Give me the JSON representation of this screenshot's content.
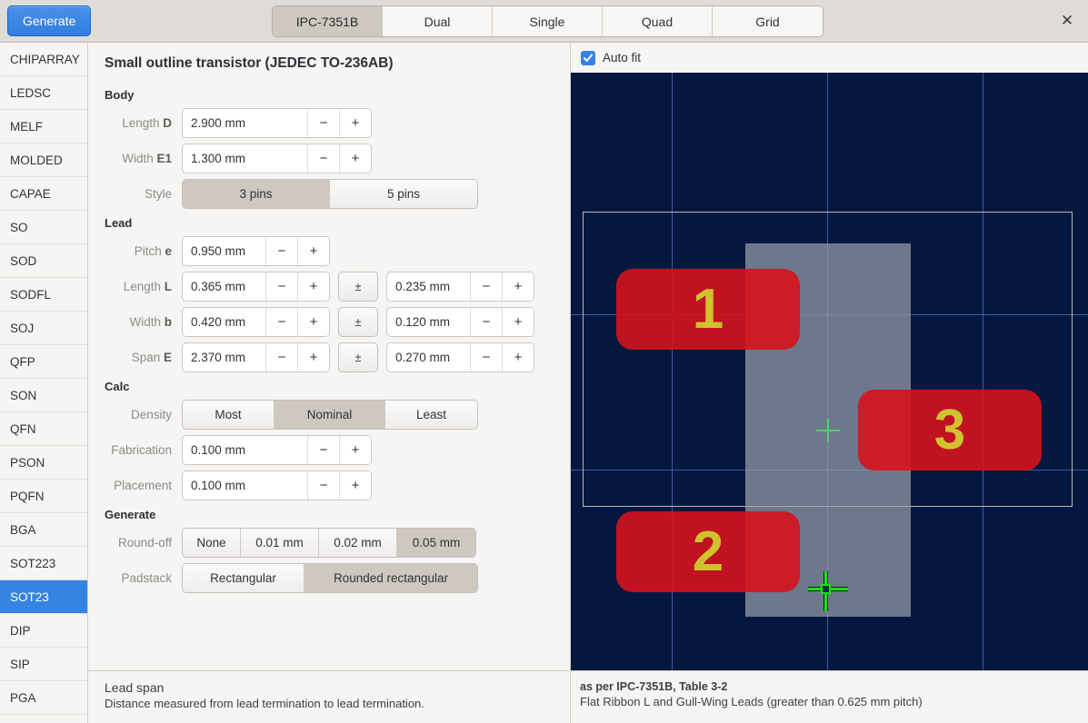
{
  "header": {
    "generate_label": "Generate",
    "close_icon": "close-icon",
    "tabs": [
      {
        "label": "IPC-7351B",
        "active": true
      },
      {
        "label": "Dual",
        "active": false
      },
      {
        "label": "Single",
        "active": false
      },
      {
        "label": "Quad",
        "active": false
      },
      {
        "label": "Grid",
        "active": false
      }
    ]
  },
  "sidebar": {
    "items": [
      {
        "label": "CHIPARRAY",
        "selected": false
      },
      {
        "label": "LEDSC",
        "selected": false
      },
      {
        "label": "MELF",
        "selected": false
      },
      {
        "label": "MOLDED",
        "selected": false
      },
      {
        "label": "CAPAE",
        "selected": false
      },
      {
        "label": "SO",
        "selected": false
      },
      {
        "label": "SOD",
        "selected": false
      },
      {
        "label": "SODFL",
        "selected": false
      },
      {
        "label": "SOJ",
        "selected": false
      },
      {
        "label": "QFP",
        "selected": false
      },
      {
        "label": "SON",
        "selected": false
      },
      {
        "label": "QFN",
        "selected": false
      },
      {
        "label": "PSON",
        "selected": false
      },
      {
        "label": "PQFN",
        "selected": false
      },
      {
        "label": "BGA",
        "selected": false
      },
      {
        "label": "SOT223",
        "selected": false
      },
      {
        "label": "SOT23",
        "selected": true
      },
      {
        "label": "DIP",
        "selected": false
      },
      {
        "label": "SIP",
        "selected": false
      },
      {
        "label": "PGA",
        "selected": false
      }
    ]
  },
  "form": {
    "title": "Small outline transistor (JEDEC TO-236AB)",
    "sections": {
      "body": {
        "heading": "Body",
        "length": {
          "label": "Length",
          "symbol": "D",
          "value": "2.900 mm"
        },
        "width": {
          "label": "Width",
          "symbol": "E1",
          "value": "1.300 mm"
        },
        "style": {
          "label": "Style",
          "options": [
            {
              "label": "3 pins",
              "active": true
            },
            {
              "label": "5 pins",
              "active": false
            }
          ]
        }
      },
      "lead": {
        "heading": "Lead",
        "pitch": {
          "label": "Pitch",
          "symbol": "e",
          "value": "0.950 mm"
        },
        "length": {
          "label": "Length",
          "symbol": "L",
          "value": "0.365 mm",
          "tol_symbol": "±",
          "tol_value": "0.235 mm"
        },
        "width": {
          "label": "Width",
          "symbol": "b",
          "value": "0.420 mm",
          "tol_symbol": "±",
          "tol_value": "0.120 mm"
        },
        "span": {
          "label": "Span",
          "symbol": "E",
          "value": "2.370 mm",
          "tol_symbol": "±",
          "tol_value": "0.270 mm"
        }
      },
      "calc": {
        "heading": "Calc",
        "density": {
          "label": "Density",
          "options": [
            {
              "label": "Most",
              "active": false
            },
            {
              "label": "Nominal",
              "active": true
            },
            {
              "label": "Least",
              "active": false
            }
          ]
        },
        "fabrication": {
          "label": "Fabrication",
          "value": "0.100 mm"
        },
        "placement": {
          "label": "Placement",
          "value": "0.100 mm"
        }
      },
      "generate": {
        "heading": "Generate",
        "roundoff": {
          "label": "Round-off",
          "options": [
            {
              "label": "None",
              "active": false
            },
            {
              "label": "0.01 mm",
              "active": false
            },
            {
              "label": "0.02 mm",
              "active": false
            },
            {
              "label": "0.05 mm",
              "active": true
            }
          ]
        },
        "padstack": {
          "label": "Padstack",
          "options": [
            {
              "label": "Rectangular",
              "active": false
            },
            {
              "label": "Rounded rectangular",
              "active": true
            }
          ]
        }
      }
    },
    "spin_minus": "−",
    "spin_plus": "+"
  },
  "status_left": {
    "title": "Lead span",
    "description": "Distance measured from lead termination to lead termination."
  },
  "status_right": {
    "title": "as per IPC-7351B, Table 3-2",
    "description": "Flat Ribbon L and Gull-Wing Leads (greater than 0.625 mm pitch)"
  },
  "preview": {
    "autofit_label": "Auto fit",
    "autofit_checked": true,
    "pads": [
      {
        "number": "1"
      },
      {
        "number": "2"
      },
      {
        "number": "3"
      }
    ],
    "colors": {
      "background": "#04173f",
      "grid": "#3c5d9e",
      "pad": "#d6121c",
      "pad_number": "#cfc22e",
      "body": "#969eaa",
      "courtyard": "#b9b8b2",
      "cursor": "#18e018",
      "origin": "#4fd06a"
    }
  }
}
